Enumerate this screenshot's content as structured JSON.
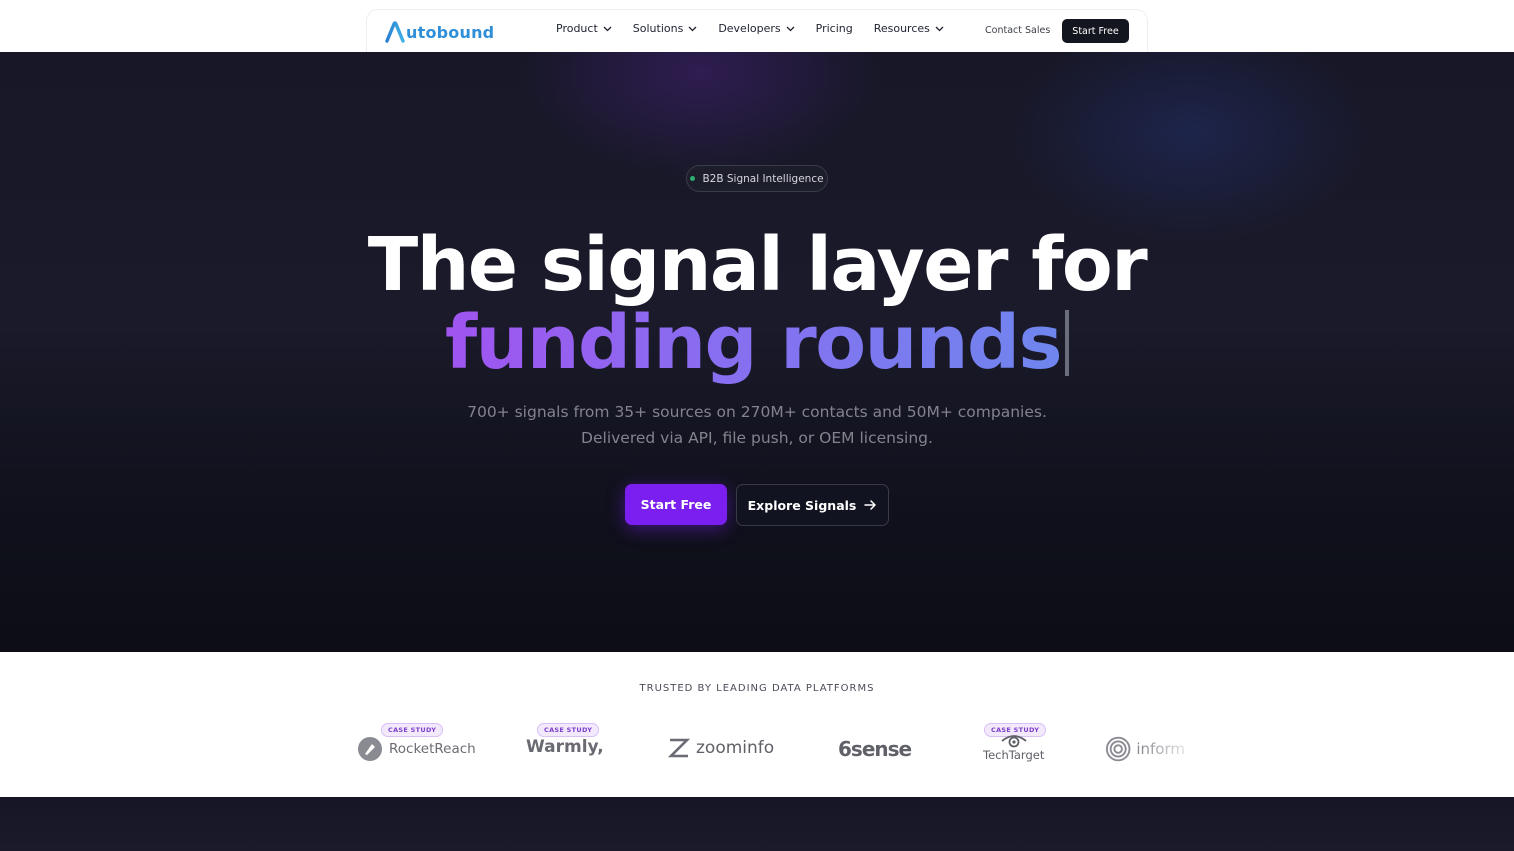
{
  "brand": {
    "logo_text": "utobound",
    "logo_mark": "A",
    "logo_color": "#2f8fd8"
  },
  "nav": {
    "items": [
      {
        "label": "Product",
        "has_dropdown": true
      },
      {
        "label": "Solutions",
        "has_dropdown": true
      },
      {
        "label": "Developers",
        "has_dropdown": true
      },
      {
        "label": "Pricing",
        "has_dropdown": false
      },
      {
        "label": "Resources",
        "has_dropdown": true
      }
    ],
    "contact_label": "Contact Sales",
    "start_label": "Start Free"
  },
  "hero": {
    "badge": "B2B Signal Intelligence",
    "headline_line1": "The signal layer for",
    "headline_line2": "funding rounds",
    "subtitle_line1": "700+ signals from 35+ sources on 270M+ contacts and 50M+ companies.",
    "subtitle_line2": "Delivered via API, file push, or OEM licensing.",
    "primary_cta": "Start Free",
    "secondary_cta": "Explore Signals",
    "accent_color": "#7b1ff0"
  },
  "trusted": {
    "heading": "TRUSTED BY LEADING DATA PLATFORMS",
    "case_study_label": "CASE STUDY",
    "logos": [
      {
        "name": "RocketReach",
        "case_study": true
      },
      {
        "name": "Warmly,",
        "case_study": true
      },
      {
        "name": "zoominfo",
        "case_study": false
      },
      {
        "name": "6sense",
        "case_study": false
      },
      {
        "name": "TechTarget",
        "case_study": true
      },
      {
        "name": "inform",
        "case_study": false
      }
    ]
  }
}
